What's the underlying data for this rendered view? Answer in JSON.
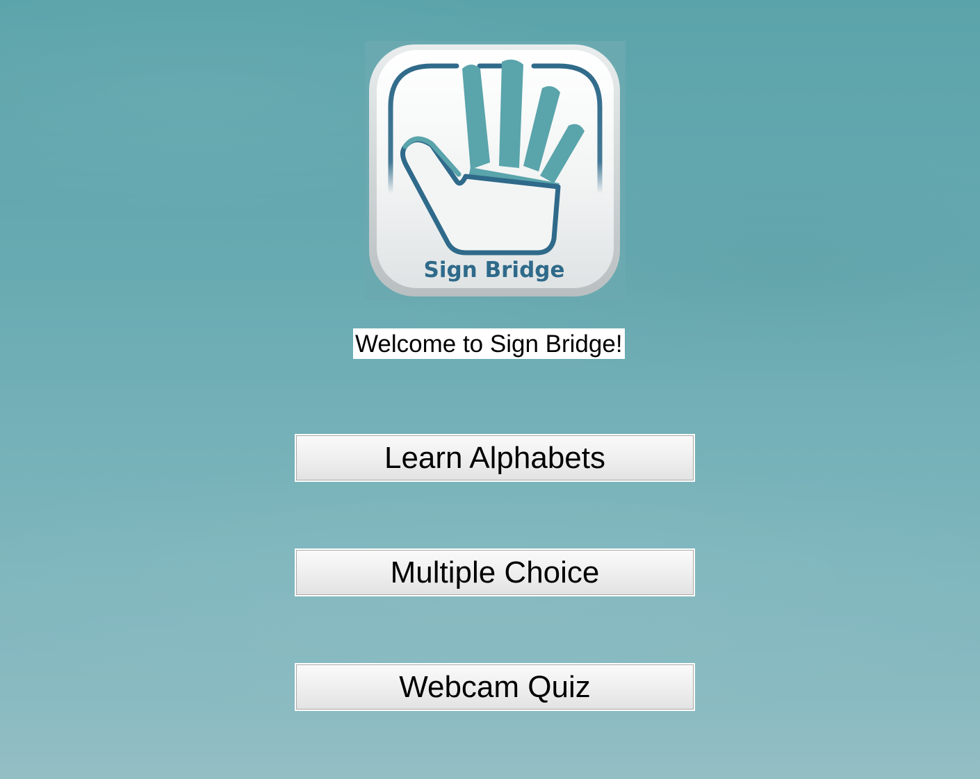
{
  "logo": {
    "icon": "hand-icon",
    "text": "Sign Bridge",
    "colors": {
      "primary": "#2f6a8a",
      "accent": "#5aa4ab"
    }
  },
  "welcome_text": "Welcome to Sign Bridge!",
  "menu": {
    "learn_alphabets": "Learn Alphabets",
    "multiple_choice": "Multiple Choice",
    "webcam_quiz": "Webcam Quiz"
  },
  "colors": {
    "background_top": "#5ba3aa",
    "background_bottom": "#93bec4",
    "button_face": "#eeeeee"
  }
}
